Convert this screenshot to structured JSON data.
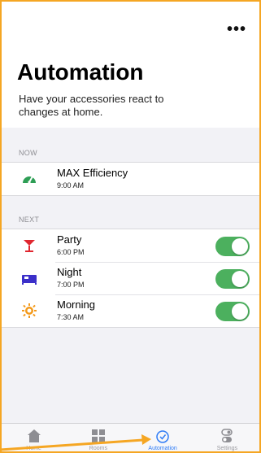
{
  "header": {
    "more_label": "•••",
    "title": "Automation",
    "subtitle": "Have your accessories react to changes at home."
  },
  "now": {
    "label": "NOW",
    "items": [
      {
        "name": "MAX Efficiency",
        "time": "9:00 AM",
        "icon": "gauge-icon",
        "color": "#2e9e55"
      }
    ]
  },
  "next": {
    "label": "NEXT",
    "items": [
      {
        "name": "Party",
        "time": "6:00 PM",
        "icon": "cocktail-icon",
        "color": "#e0262f",
        "enabled": true
      },
      {
        "name": "Night",
        "time": "7:00 PM",
        "icon": "bed-icon",
        "color": "#3b2fc9",
        "enabled": true
      },
      {
        "name": "Morning",
        "time": "7:30 AM",
        "icon": "sun-icon",
        "color": "#f39a1c",
        "enabled": true
      }
    ]
  },
  "tabbar": {
    "tabs": [
      {
        "label": "Home",
        "icon": "house-icon",
        "active": false
      },
      {
        "label": "Rooms",
        "icon": "rooms-grid-icon",
        "active": false
      },
      {
        "label": "Automation",
        "icon": "clock-icon",
        "active": true
      },
      {
        "label": "Settings",
        "icon": "toggles-icon",
        "active": false
      }
    ]
  },
  "colors": {
    "accent": "#2f7cf6",
    "toggle_on": "#4cb05e",
    "annotation": "#f5a623"
  }
}
